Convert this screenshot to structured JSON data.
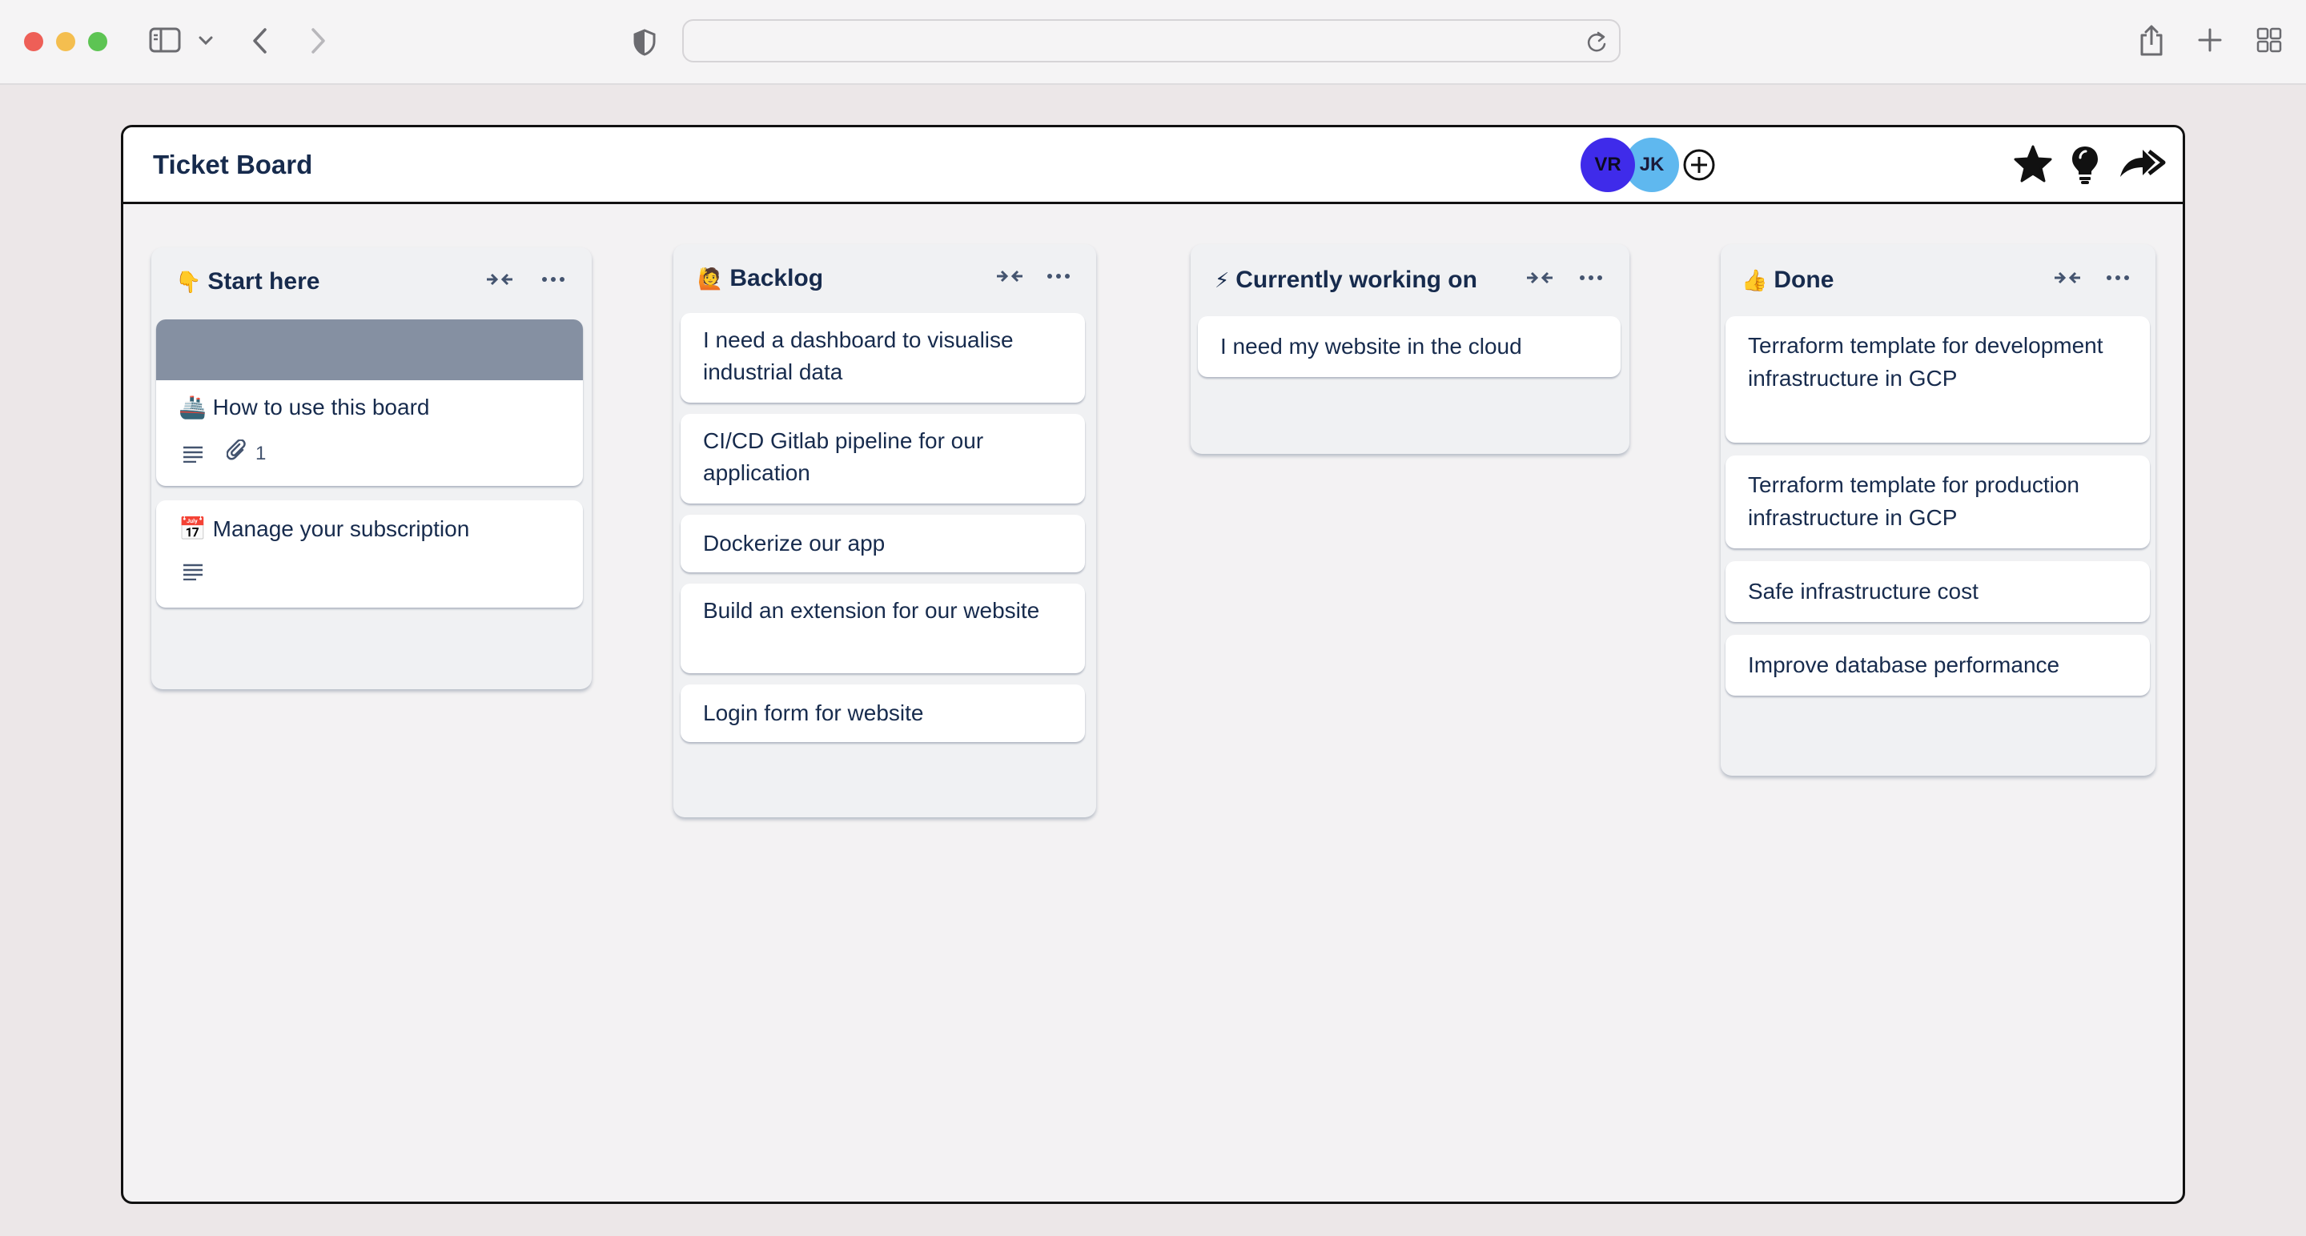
{
  "browser": {
    "url": ""
  },
  "app": {
    "title": "Ticket Board",
    "members": [
      {
        "initials": "VR",
        "color": "#3f2bea"
      },
      {
        "initials": "JK",
        "color": "#5fb8ef"
      }
    ]
  },
  "lists": [
    {
      "emoji": "👇",
      "title": "Start here",
      "cards": [
        {
          "title": "How to use this board",
          "emoji": "🚢",
          "cover_color": "#8590a2",
          "attachments": "1"
        },
        {
          "title": "Manage your subscription",
          "emoji": "📅"
        }
      ]
    },
    {
      "emoji": "🙋",
      "title": "Backlog",
      "cards": [
        {
          "title": "I need a dashboard to visualise industrial data"
        },
        {
          "title": "CI/CD Gitlab pipeline for our application"
        },
        {
          "title": "Dockerize our app"
        },
        {
          "title": "Build an extension for our website"
        },
        {
          "title": "Login form for website"
        }
      ]
    },
    {
      "emoji": "⚡",
      "title": "Currently working on",
      "cards": [
        {
          "title": "I need my website in the cloud"
        }
      ]
    },
    {
      "emoji": "👍",
      "title": "Done",
      "cards": [
        {
          "title": "Terraform template for development infrastructure in GCP"
        },
        {
          "title": "Terraform template for production infrastructure in GCP"
        },
        {
          "title": "Safe infrastructure cost"
        },
        {
          "title": "Improve database performance"
        }
      ]
    }
  ]
}
